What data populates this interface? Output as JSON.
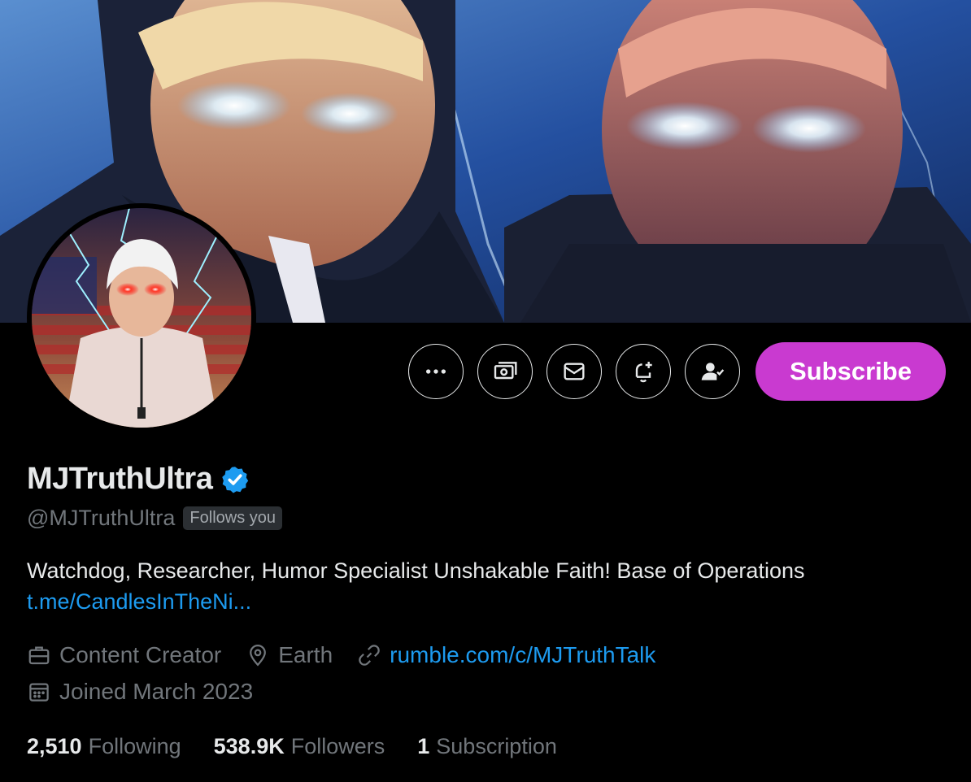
{
  "profile": {
    "display_name": "MJTruthUltra",
    "handle": "@MJTruthUltra",
    "follows_you": "Follows you",
    "bio": "Watchdog, Researcher, Humor Specialist Unshakable Faith! Base of Operations",
    "bio_link": "t.me/CandlesInTheNi...",
    "category": "Content Creator",
    "location": "Earth",
    "website": "rumble.com/c/MJTruthTalk",
    "joined": "Joined March 2023"
  },
  "actions": {
    "subscribe_label": "Subscribe"
  },
  "stats": {
    "following_count": "2,510",
    "following_label": "Following",
    "followers_count": "538.9K",
    "followers_label": "Followers",
    "subscription_count": "1",
    "subscription_label": "Subscription"
  },
  "colors": {
    "accent_subscribe": "#c93ad0",
    "link": "#1d9bf0",
    "verified": "#1d9bf0",
    "muted_text": "#71767b"
  },
  "icons": [
    "more-icon",
    "tip-icon",
    "message-icon",
    "notify-icon",
    "follow-check-icon",
    "verified-icon",
    "briefcase-icon",
    "location-icon",
    "link-icon",
    "calendar-icon"
  ]
}
